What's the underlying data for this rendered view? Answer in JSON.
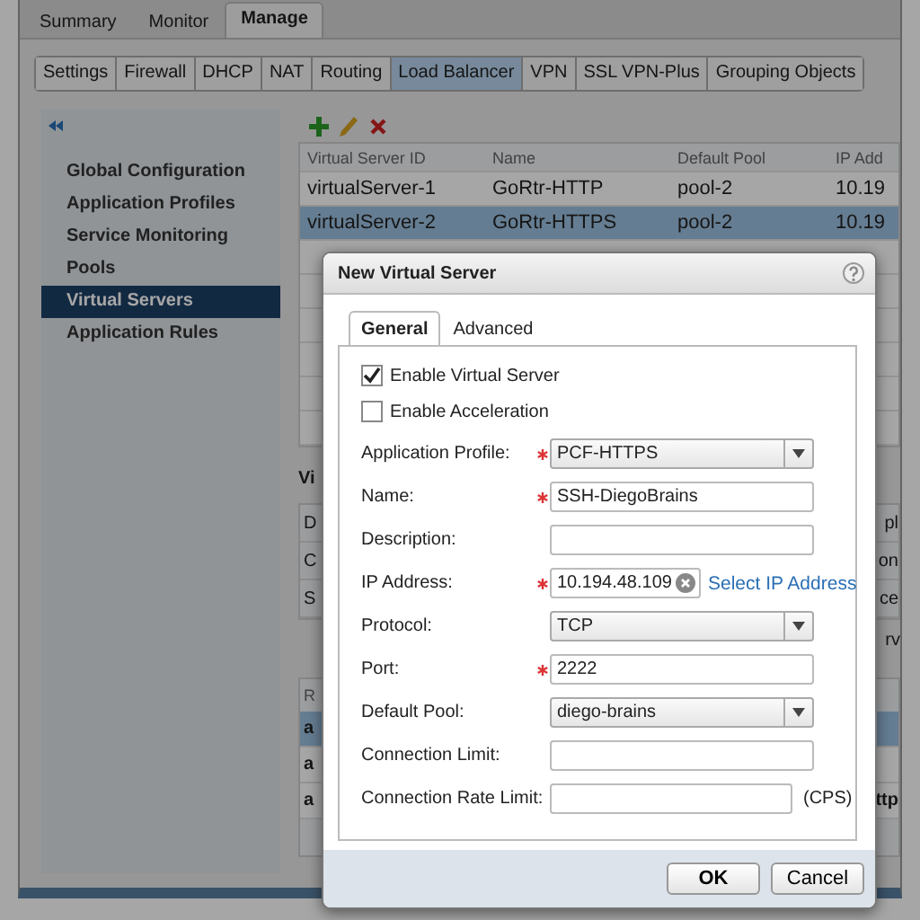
{
  "top_tabs": [
    {
      "label": "Summary",
      "selected": false
    },
    {
      "label": "Monitor",
      "selected": false
    },
    {
      "label": "Manage",
      "selected": true
    }
  ],
  "sub_tabs": [
    {
      "label": "Settings",
      "selected": false
    },
    {
      "label": "Firewall",
      "selected": false
    },
    {
      "label": "DHCP",
      "selected": false
    },
    {
      "label": "NAT",
      "selected": false
    },
    {
      "label": "Routing",
      "selected": false
    },
    {
      "label": "Load Balancer",
      "selected": true
    },
    {
      "label": "VPN",
      "selected": false
    },
    {
      "label": "SSL VPN-Plus",
      "selected": false
    },
    {
      "label": "Grouping Objects",
      "selected": false
    }
  ],
  "sidebar": {
    "items": [
      {
        "label": "Global Configuration",
        "selected": false
      },
      {
        "label": "Application Profiles",
        "selected": false
      },
      {
        "label": "Service Monitoring",
        "selected": false
      },
      {
        "label": "Pools",
        "selected": false
      },
      {
        "label": "Virtual Servers",
        "selected": true
      },
      {
        "label": "Application Rules",
        "selected": false
      }
    ]
  },
  "table": {
    "columns": [
      "Virtual Server ID",
      "Name",
      "Default Pool",
      "IP Add"
    ],
    "rows": [
      {
        "cells": [
          "virtualServer-1",
          "GoRtr-HTTP",
          "pool-2",
          "10.19"
        ],
        "selected": false
      },
      {
        "cells": [
          "virtualServer-2",
          "GoRtr-HTTPS",
          "pool-2",
          "10.19"
        ],
        "selected": true
      }
    ]
  },
  "details": {
    "label": "Vi",
    "rows": [
      [
        "D",
        "pl"
      ],
      [
        "C",
        "on"
      ],
      [
        "S",
        "ce"
      ]
    ],
    "after": "rv"
  },
  "rules": {
    "header": "R",
    "rows": [
      {
        "cells": [
          "a",
          ""
        ],
        "selected": true
      },
      {
        "cells": [
          "a",
          ""
        ],
        "selected": false
      },
      {
        "cells": [
          "a",
          "ttp"
        ],
        "selected": false
      }
    ]
  },
  "dialog": {
    "title": "New Virtual Server",
    "tabs": [
      {
        "label": "General",
        "selected": true
      },
      {
        "label": "Advanced",
        "selected": false
      }
    ],
    "checkboxes": [
      {
        "label": "Enable Virtual Server",
        "checked": true
      },
      {
        "label": "Enable Acceleration",
        "checked": false
      }
    ],
    "fields": [
      {
        "kind": "select",
        "label": "Application Profile:",
        "required": true,
        "value": "PCF-HTTPS"
      },
      {
        "kind": "text",
        "label": "Name:",
        "required": true,
        "value": "SSH-DiegoBrains"
      },
      {
        "kind": "text",
        "label": "Description:",
        "required": false
      },
      {
        "kind": "ip",
        "label": "IP Address:",
        "required": true,
        "value": "10.194.48.109",
        "link": "Select IP Address"
      },
      {
        "kind": "select",
        "label": "Protocol:",
        "required": false,
        "value": "TCP"
      },
      {
        "kind": "text",
        "label": "Port:",
        "required": true,
        "value": "2222"
      },
      {
        "kind": "select",
        "label": "Default Pool:",
        "required": false,
        "value": "diego-brains"
      },
      {
        "kind": "text",
        "label": "Connection Limit:",
        "required": false
      },
      {
        "kind": "short",
        "label": "Connection Rate Limit:",
        "required": false,
        "suffix": "(CPS)"
      }
    ],
    "buttons": [
      "OK",
      "Cancel"
    ]
  }
}
